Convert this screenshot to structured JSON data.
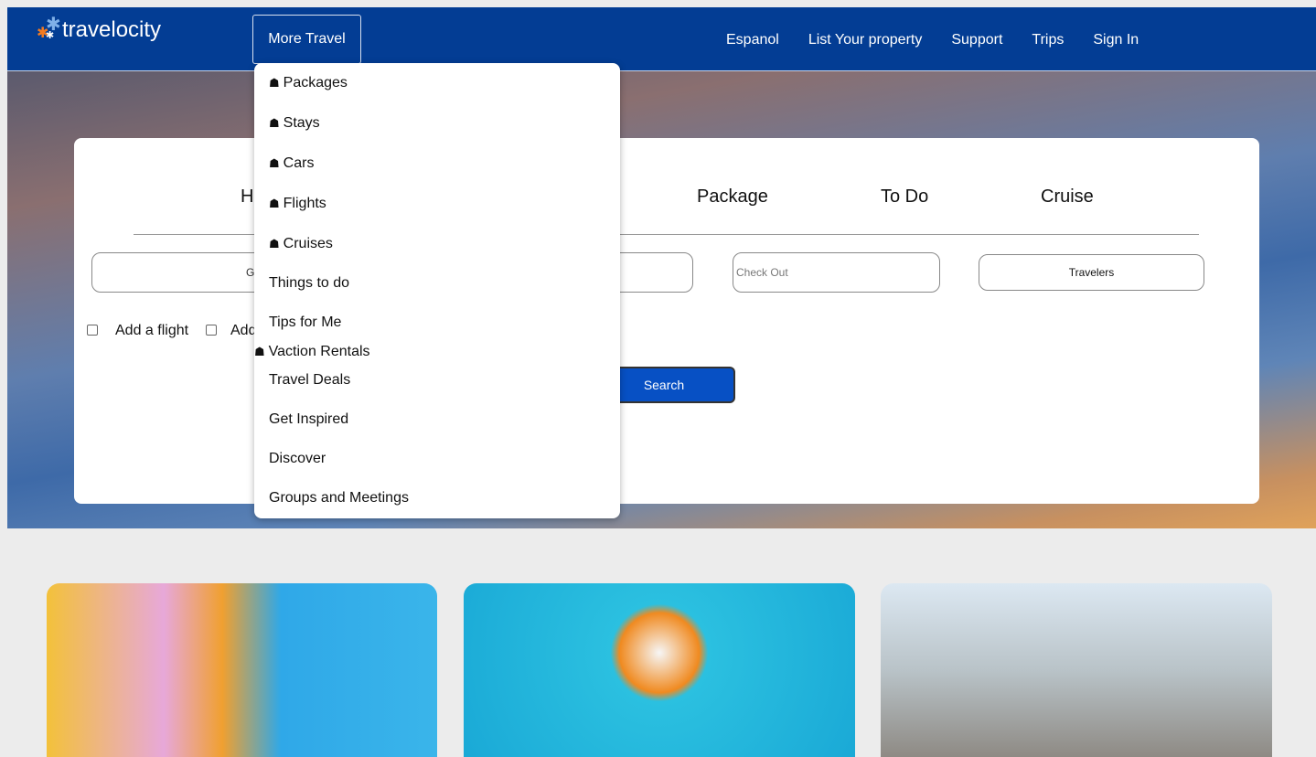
{
  "header": {
    "logo": "travelocity",
    "more_travel": "More Travel",
    "nav": [
      "Espanol",
      "List Your property",
      "Support",
      "Trips",
      "Sign In"
    ]
  },
  "dropdown": {
    "items": [
      {
        "label": "Packages",
        "icon": "home-icon"
      },
      {
        "label": "Stays",
        "icon": "home-icon"
      },
      {
        "label": "Cars",
        "icon": "home-icon"
      },
      {
        "label": "Flights",
        "icon": "home-icon"
      },
      {
        "label": "Cruises",
        "icon": "home-icon"
      },
      {
        "label": "Things to do"
      },
      {
        "label": "Tips for Me"
      },
      {
        "label": "Vaction Rentals",
        "icon": "home-icon"
      },
      {
        "label": "Travel Deals"
      },
      {
        "label": "Get Inspired"
      },
      {
        "label": "Discover"
      },
      {
        "label": "Groups and Meetings"
      }
    ]
  },
  "search": {
    "tabs": [
      "H",
      "Package",
      "To Do",
      "Cruise"
    ],
    "going_to_partial": "G",
    "check_out_placeholder": "Check Out",
    "travelers": "Travelers",
    "add_flight": "Add a flight",
    "add_partial": "Add",
    "search_button": "Search"
  },
  "colors": {
    "header": "#033d94",
    "search_button": "#0750c4"
  }
}
